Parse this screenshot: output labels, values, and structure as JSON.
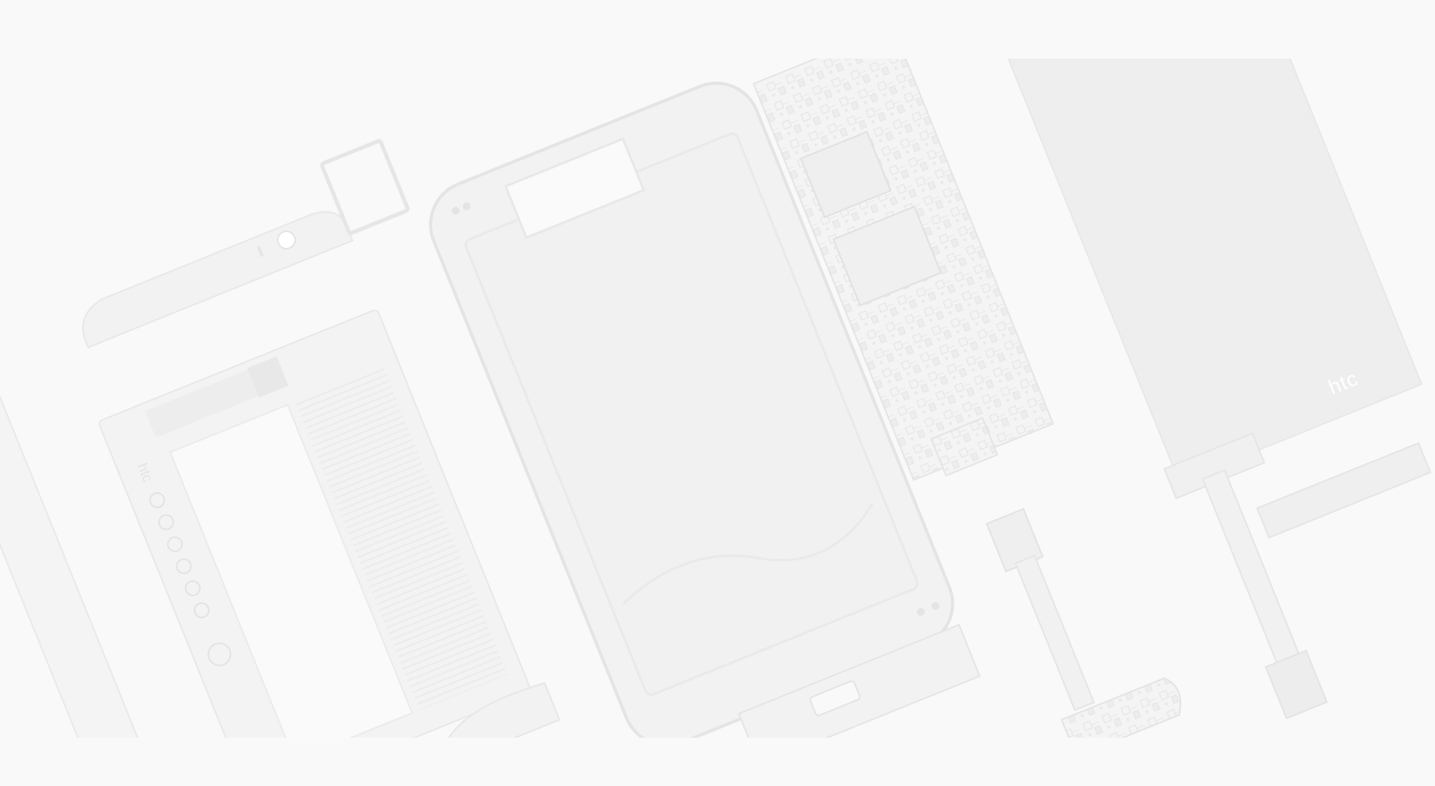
{
  "image": {
    "description_role": "hero-background",
    "phone_logo": "htc"
  },
  "colors": {
    "page_background": "#f9f9f9",
    "image_background": "#f6f6f6",
    "part_fill": "#eeeeee",
    "part_stroke": "#dcdcdc",
    "screen_fill": "#e6e6e6",
    "accent": "#d0d0d0"
  }
}
